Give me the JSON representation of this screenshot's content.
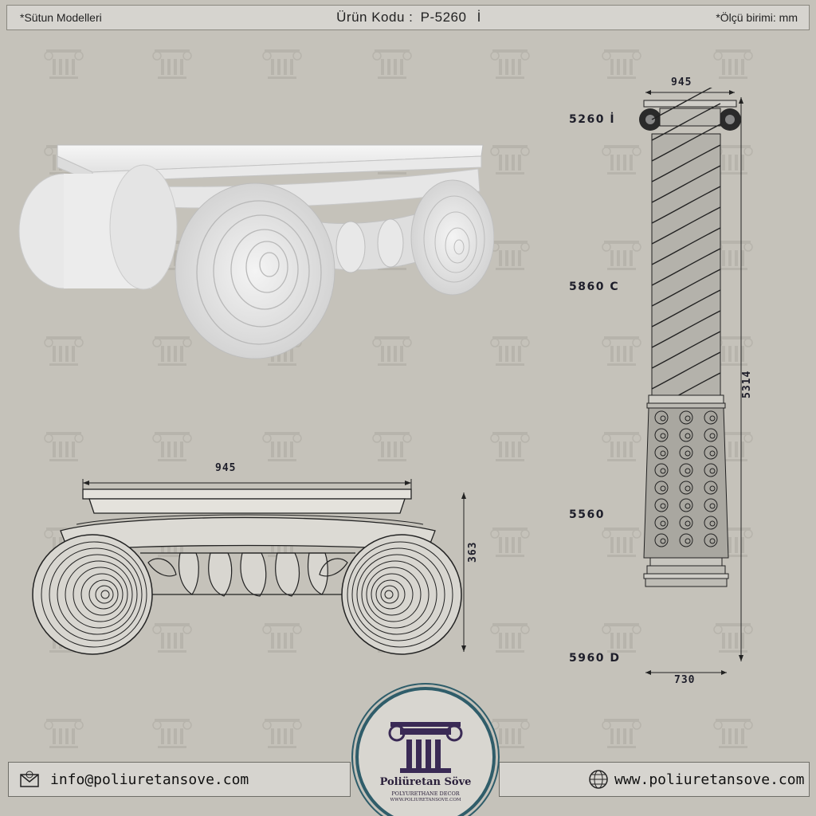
{
  "header": {
    "left": "*Sütun  Modelleri",
    "center_prefix": "Ürün Kodu :",
    "center_code": "P-5260",
    "center_variant": "İ",
    "right": "*Ölçü birimi: mm"
  },
  "drawing": {
    "front_width": "945",
    "front_height": "363",
    "column_top_width": "945",
    "column_base_width": "730",
    "column_total_height": "5314",
    "part_labels": [
      "5260 İ",
      "5860 C",
      "5560",
      "5960 D"
    ]
  },
  "footer": {
    "email": "info@poliuretansove.com",
    "website": "www.poliuretansove.com",
    "email_icon": "envelope-icon",
    "web_icon": "globe-icon"
  },
  "logo": {
    "title": "Poliüretan Söve",
    "subtitle": "POLYURETHANE DECOR",
    "url": "WWW.POLIURETANSOVE.COM"
  },
  "colors": {
    "background": "#c5c2ba",
    "accent": "#2f5d6a",
    "logo_purple": "#3a2a55"
  }
}
